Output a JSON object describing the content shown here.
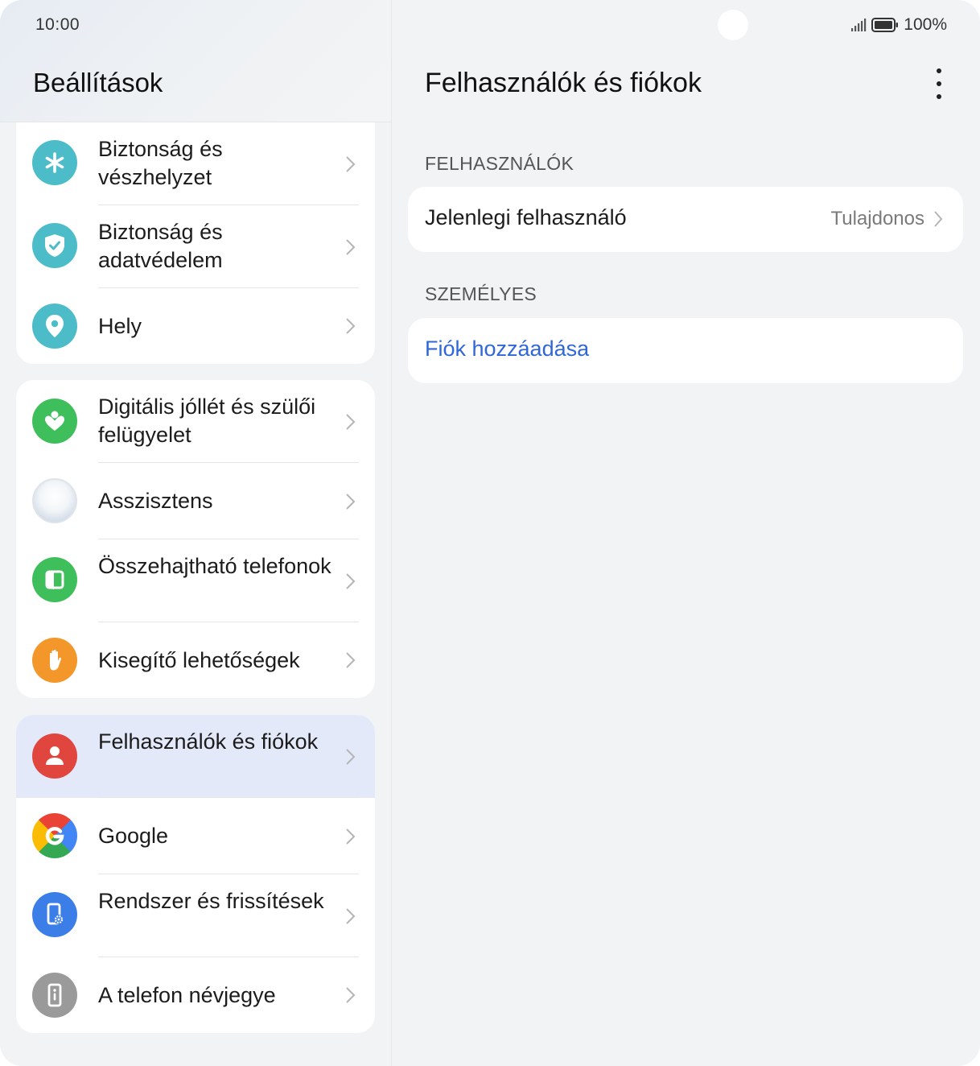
{
  "status_bar": {
    "time": "10:00",
    "battery": "100%"
  },
  "left": {
    "title": "Beállítások",
    "groups": [
      {
        "items": [
          {
            "label": "Biztonság és vészhelyzet",
            "icon": "asterisk-icon",
            "color": "#4cbdc8"
          },
          {
            "label": "Biztonság és adatvédelem",
            "icon": "shield-check-icon",
            "color": "#4cbdc8"
          },
          {
            "label": "Hely",
            "icon": "location-pin-icon",
            "color": "#4cbdc8"
          }
        ]
      },
      {
        "items": [
          {
            "label": "Digitális jóllét és szülői felügyelet",
            "icon": "heart-person-icon",
            "color": "#3fbf5b"
          },
          {
            "label": "Asszisztens",
            "icon": "assistant-orb-icon",
            "color": "#dfe6ef"
          },
          {
            "label": "Összehajtható telefonok",
            "icon": "foldable-phone-icon",
            "color": "#3fbf5b"
          },
          {
            "label": "Kisegítő lehetőségek",
            "icon": "hand-icon",
            "color": "#f3972b"
          }
        ]
      },
      {
        "items": [
          {
            "label": "Felhasználók és fiókok",
            "icon": "user-icon",
            "color": "#e0453e",
            "active": true
          },
          {
            "label": "Google",
            "icon": "google-icon",
            "color": "#4285f4"
          },
          {
            "label": "Rendszer és frissítések",
            "icon": "phone-settings-icon",
            "color": "#3b7ee8"
          },
          {
            "label": "A telefon névjegye",
            "icon": "phone-info-icon",
            "color": "#9a9a9a"
          }
        ]
      }
    ]
  },
  "right": {
    "title": "Felhasználók és fiókok",
    "more_icon": "more-vertical-icon",
    "sections": [
      {
        "header": "FELHASZNÁLÓK",
        "row_label": "Jelenlegi felhasználó",
        "row_value": "Tulajdonos"
      },
      {
        "header": "SZEMÉLYES",
        "row_label": "Fiók hozzáadása"
      }
    ]
  }
}
